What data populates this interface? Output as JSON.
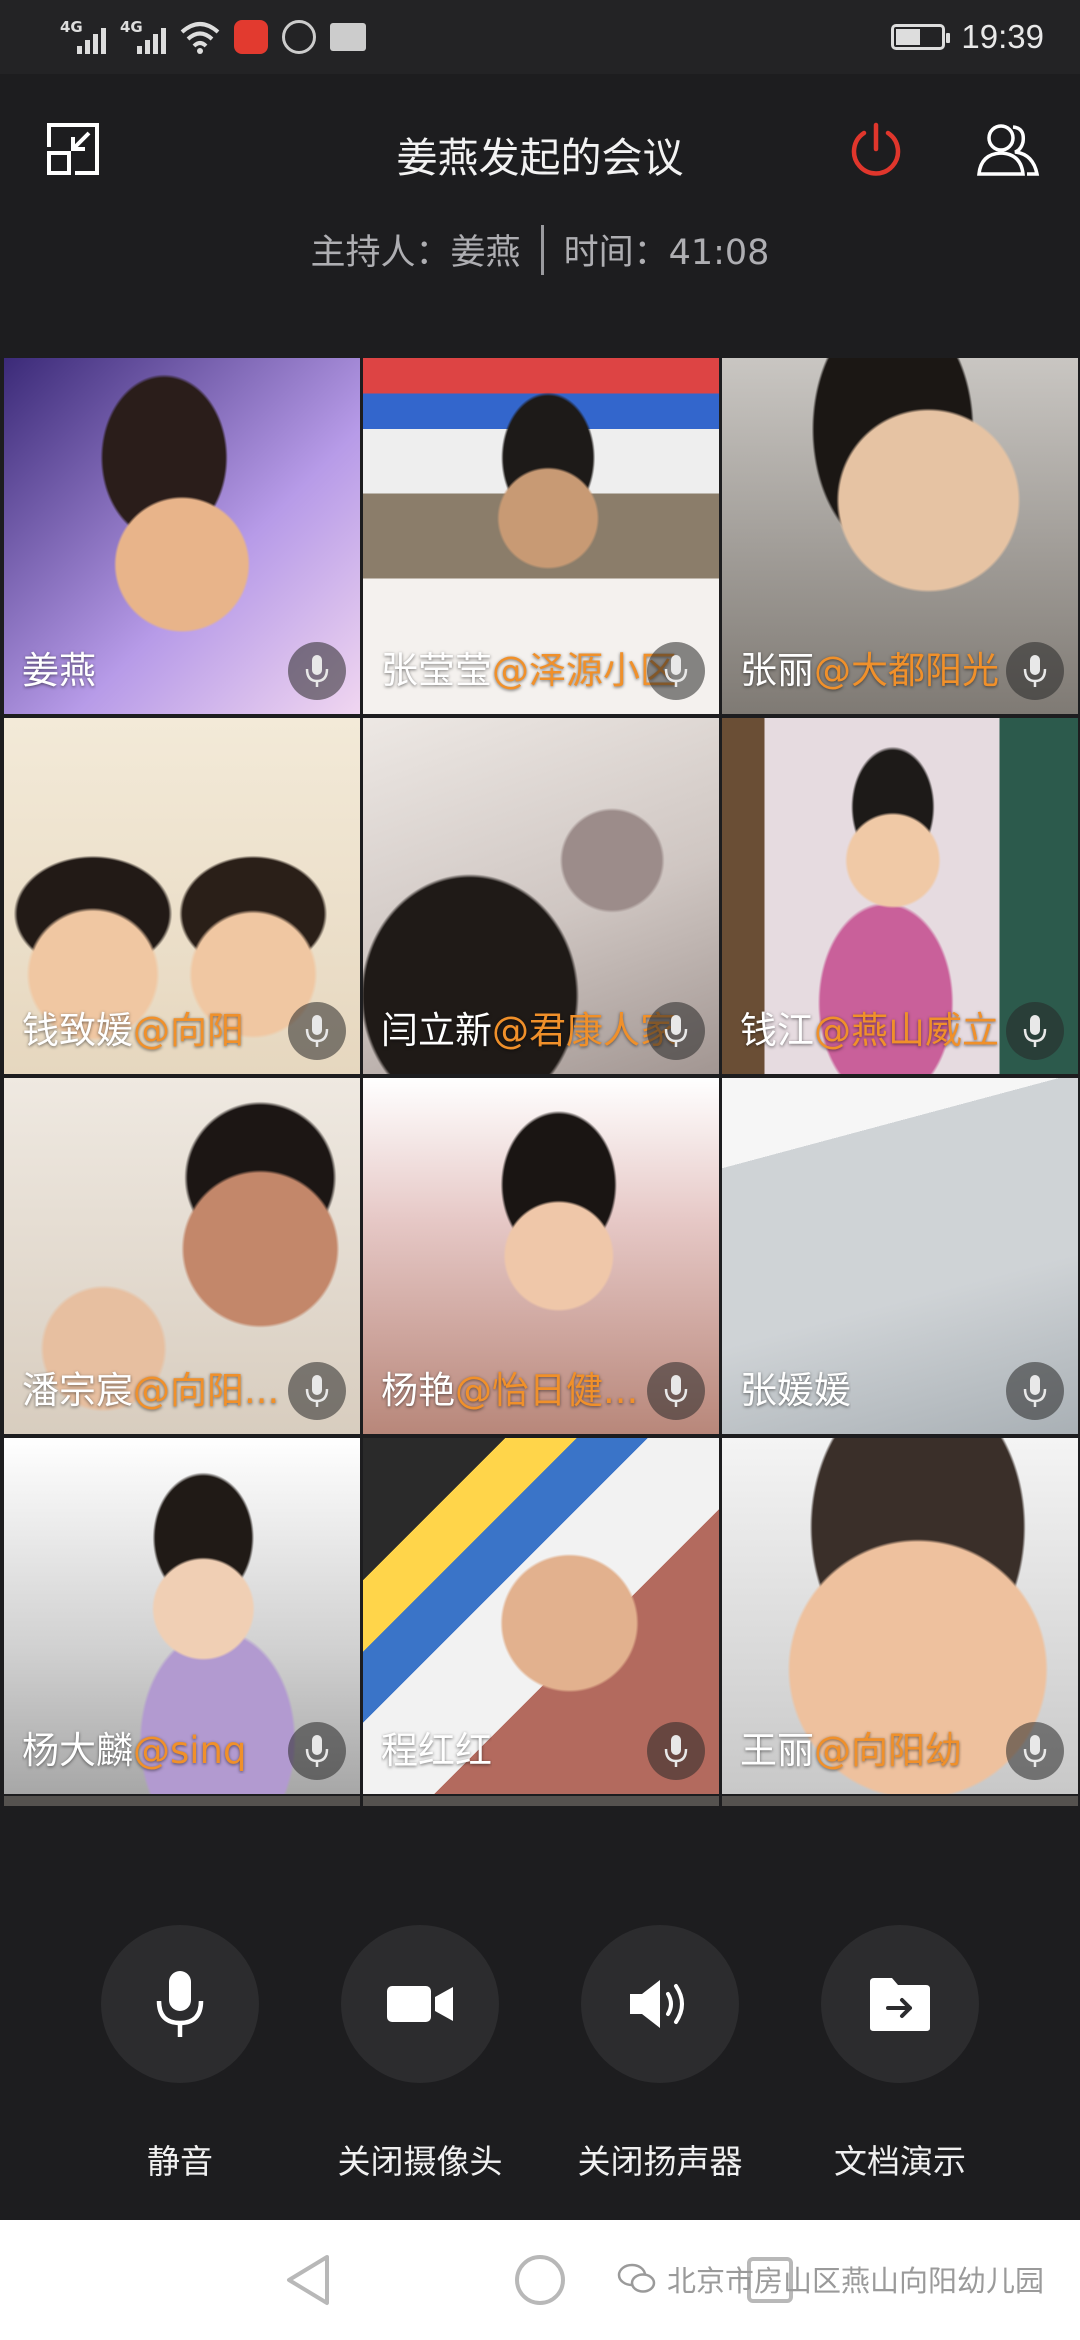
{
  "status_bar": {
    "network_1": "4G",
    "network_2": "4G",
    "time": "19:39",
    "battery_level": 0.55,
    "icons": [
      "signal-icon",
      "signal-icon",
      "wifi-icon",
      "app-notification-icon",
      "app-notification-icon",
      "folder-icon",
      "battery-icon"
    ]
  },
  "header": {
    "title": "姜燕发起的会议",
    "host_label": "主持人：",
    "host_name": "姜燕",
    "time_label": "时间：",
    "elapsed": "41:08",
    "icons": [
      "minimize-window-icon",
      "power-icon",
      "participants-icon"
    ],
    "accent_color": "#e0362c"
  },
  "participants": [
    {
      "name": "姜燕",
      "org": "",
      "scene": "purple"
    },
    {
      "name": "张莹莹",
      "org": "@泽源小区",
      "scene": "flags"
    },
    {
      "name": "张丽",
      "org": "@大都阳光",
      "scene": "grey"
    },
    {
      "name": "钱致媛",
      "org": "@向阳",
      "scene": "cream"
    },
    {
      "name": "闫立新",
      "org": "@君康人家",
      "scene": "blur"
    },
    {
      "name": "钱江",
      "org": "@燕山威立",
      "scene": "room"
    },
    {
      "name": "潘宗宸",
      "org": "@向阳...",
      "scene": "wall"
    },
    {
      "name": "杨艳",
      "org": "@怡日健...",
      "scene": "pink"
    },
    {
      "name": "张媛媛",
      "org": "",
      "scene": "sofa"
    },
    {
      "name": "杨大麟",
      "org": "@sinq",
      "scene": "white"
    },
    {
      "name": "程红红",
      "org": "",
      "scene": "colorful"
    },
    {
      "name": "王丽",
      "org": "@向阳幼",
      "scene": "close"
    }
  ],
  "org_color": "#f0902a",
  "controls": [
    {
      "label": "静音",
      "icon": "microphone-icon"
    },
    {
      "label": "关闭摄像头",
      "icon": "camera-icon"
    },
    {
      "label": "关闭扬声器",
      "icon": "speaker-icon"
    },
    {
      "label": "文档演示",
      "icon": "document-share-icon"
    }
  ],
  "navbar": {
    "watermark": "北京市房山区燕山向阳幼儿园",
    "icons": [
      "back-icon",
      "home-icon",
      "recents-icon",
      "wechat-icon"
    ]
  }
}
